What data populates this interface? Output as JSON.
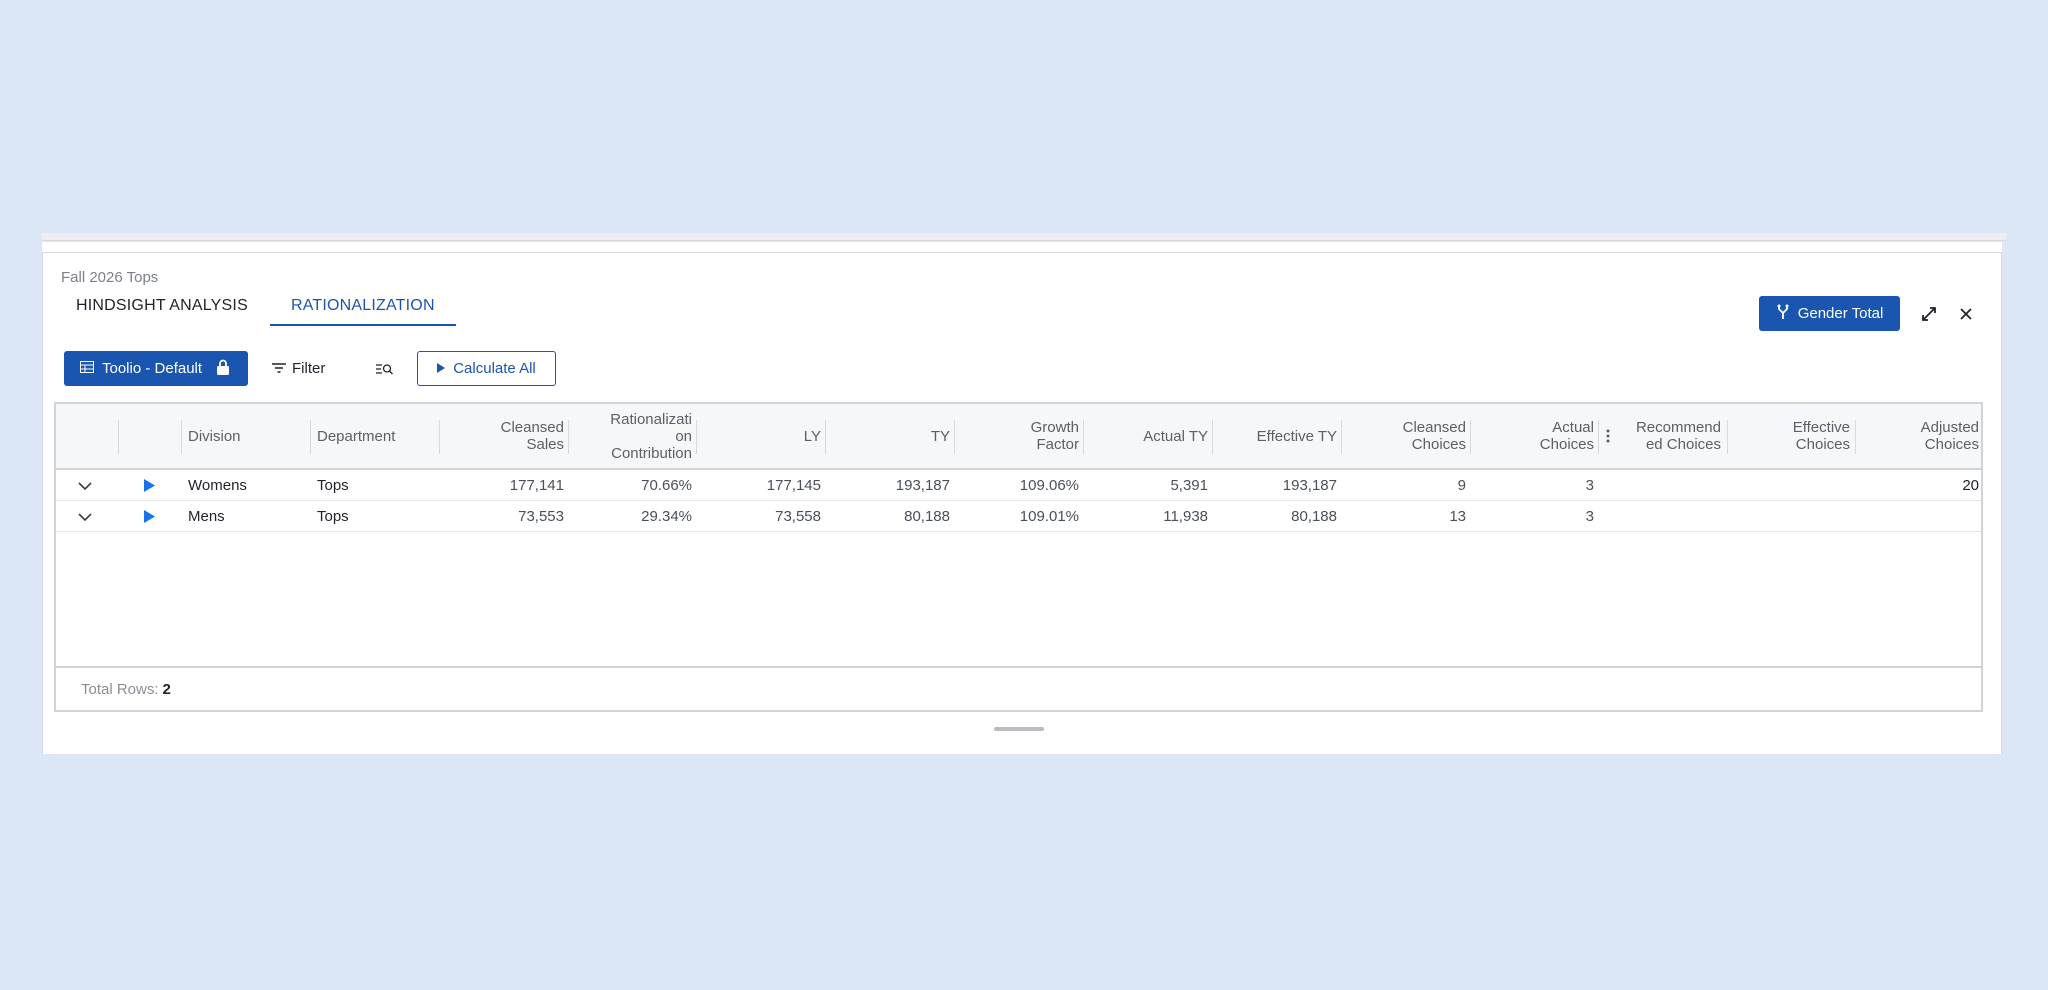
{
  "panel": {
    "title": "Fall 2026 Tops",
    "tabs": [
      {
        "label": "HINDSIGHT ANALYSIS"
      },
      {
        "label": "RATIONALIZATION"
      }
    ],
    "gender_total_label": "Gender Total",
    "expand_icon": "expand-icon",
    "close_icon": "close-icon"
  },
  "toolbar": {
    "view_label": "Toolio - Default",
    "filter_label": "Filter",
    "calculate_label": "Calculate All"
  },
  "grid": {
    "headers": {
      "division": "Division",
      "department": "Department",
      "cleansed_sales": [
        "Cleansed",
        "Sales"
      ],
      "rationalization": [
        "Rationalizati",
        "on",
        "Contribution"
      ],
      "ly": "LY",
      "ty": "TY",
      "growth_factor": [
        "Growth",
        "Factor"
      ],
      "actual_ty": "Actual TY",
      "effective_ty": "Effective TY",
      "cleansed_choices": [
        "Cleansed",
        "Choices"
      ],
      "actual_choices": [
        "Actual",
        "Choices"
      ],
      "recommended_choices": [
        "Recommend",
        "ed Choices"
      ],
      "effective_choices": [
        "Effective",
        "Choices"
      ],
      "adjusted_choices": [
        "Adjusted",
        "Choices"
      ]
    },
    "rows": [
      {
        "division": "Womens",
        "department": "Tops",
        "cleansed_sales": "177,141",
        "rationalization": "70.66%",
        "ly": "177,145",
        "ty": "193,187",
        "growth_factor": "109.06%",
        "actual_ty": "5,391",
        "effective_ty": "193,187",
        "cleansed_choices": "9",
        "actual_choices": "3",
        "recommended_choices": "",
        "effective_choices": "",
        "adjusted_choices": "20"
      },
      {
        "division": "Mens",
        "department": "Tops",
        "cleansed_sales": "73,553",
        "rationalization": "29.34%",
        "ly": "73,558",
        "ty": "80,188",
        "growth_factor": "109.01%",
        "actual_ty": "11,938",
        "effective_ty": "80,188",
        "cleansed_choices": "13",
        "actual_choices": "3",
        "recommended_choices": "",
        "effective_choices": "",
        "adjusted_choices": ""
      }
    ],
    "footer": {
      "label": "Total Rows:",
      "count": "2"
    }
  },
  "colors": {
    "accent": "#1a56b0",
    "background": "#dbe7f7"
  }
}
